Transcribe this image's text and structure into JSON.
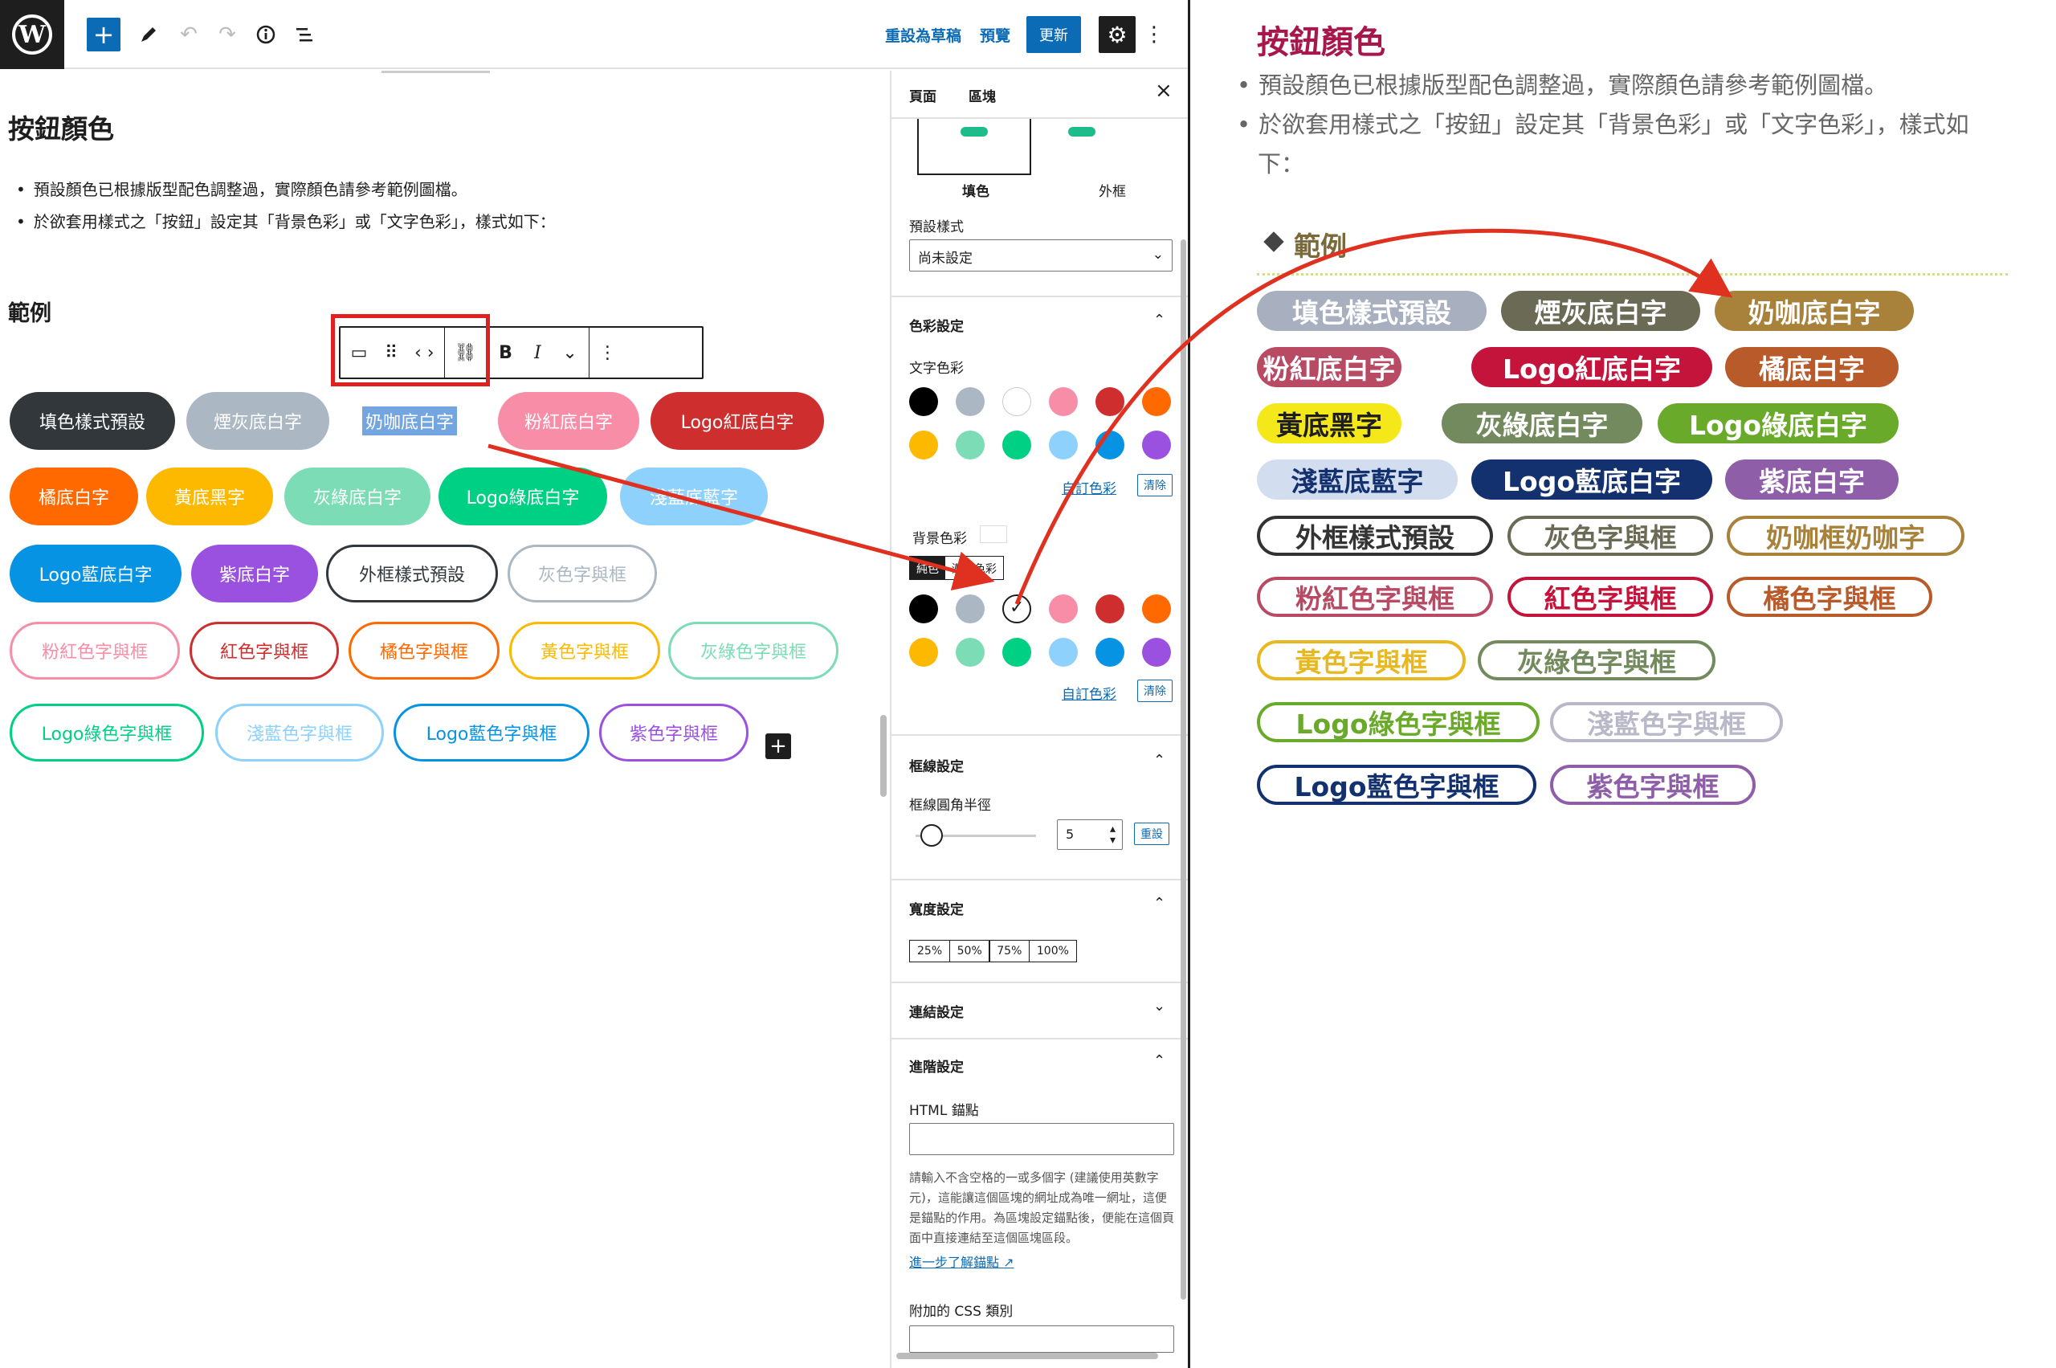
{
  "topbar": {
    "save_draft": "重設為草稿",
    "preview": "預覽",
    "update": "更新",
    "icons": [
      "wordpress-icon",
      "plus-icon",
      "pencil-icon",
      "undo-icon",
      "redo-icon",
      "info-icon",
      "list-view-icon",
      "gear-icon",
      "more-vertical-icon"
    ]
  },
  "canvas": {
    "heading": "按鈕顏色",
    "bullets": [
      "預設顏色已根據版型配色調整過，實際顏色請參考範例圖檔。",
      "於欲套用樣式之「按鈕」設定其「背景色彩」或「文字色彩」，樣式如下："
    ],
    "example_heading": "範例",
    "toolbar": {
      "bold": "B",
      "italic": "I"
    },
    "buttons": [
      {
        "label": "填色樣式預設",
        "style": "fill",
        "color": "#32373c"
      },
      {
        "label": "煙灰底白字",
        "style": "fill",
        "color": "#abb8c3"
      },
      {
        "label": "奶咖底白字",
        "style": "selected",
        "color": "#ffffff"
      },
      {
        "label": "粉紅底白字",
        "style": "fill",
        "color": "#f78da7"
      },
      {
        "label": "Logo紅底白字",
        "style": "fill",
        "color": "#cf2e2e"
      },
      {
        "label": "橘底白字",
        "style": "fill",
        "color": "#ff6900"
      },
      {
        "label": "黃底黑字",
        "style": "fill",
        "color": "#fcb900"
      },
      {
        "label": "灰綠底白字",
        "style": "fill",
        "color": "#7bdcb5"
      },
      {
        "label": "Logo綠底白字",
        "style": "fill",
        "color": "#00d084"
      },
      {
        "label": "淺藍底藍字",
        "style": "fill",
        "color": "#8ed1fc"
      },
      {
        "label": "Logo藍底白字",
        "style": "fill",
        "color": "#0693e3"
      },
      {
        "label": "紫底白字",
        "style": "fill",
        "color": "#9b51e0"
      },
      {
        "label": "外框樣式預設",
        "style": "outline",
        "color": "#32373c"
      },
      {
        "label": "灰色字與框",
        "style": "outline",
        "color": "#abb8c3"
      },
      {
        "label": "粉紅色字與框",
        "style": "outline",
        "color": "#f78da7"
      },
      {
        "label": "紅色字與框",
        "style": "outline",
        "color": "#cf2e2e"
      },
      {
        "label": "橘色字與框",
        "style": "outline",
        "color": "#ff6900"
      },
      {
        "label": "黃色字與框",
        "style": "outline",
        "color": "#fcb900"
      },
      {
        "label": "灰綠色字與框",
        "style": "outline",
        "color": "#7bdcb5"
      },
      {
        "label": "Logo綠色字與框",
        "style": "outline",
        "color": "#00d084"
      },
      {
        "label": "淺藍色字與框",
        "style": "outline",
        "color": "#8ed1fc"
      },
      {
        "label": "Logo藍色字與框",
        "style": "outline",
        "color": "#0693e3"
      },
      {
        "label": "紫色字與框",
        "style": "outline",
        "color": "#9b51e0"
      }
    ]
  },
  "sidebar": {
    "tab_page": "頁面",
    "tab_block": "區塊",
    "style_fill": "填色",
    "style_outline": "外框",
    "preset_label": "預設樣式",
    "preset_value": "尚未設定",
    "color_settings": "色彩設定",
    "text_color": "文字色彩",
    "bg_color": "背景色彩",
    "solid": "純色",
    "gradient": "漸層色彩",
    "custom_color": "自訂色彩",
    "clear": "清除",
    "palette": [
      "#000000",
      "#abb8c3",
      "#ffffff",
      "#f78da7",
      "#cf2e2e",
      "#ff6900",
      "#fcb900",
      "#7bdcb5",
      "#00d084",
      "#8ed1fc",
      "#0693e3",
      "#9b51e0"
    ],
    "border_settings": "框線設定",
    "border_radius": "框線圓角半徑",
    "radius_value": "5",
    "reset": "重設",
    "width_settings": "寬度設定",
    "widths": [
      "25%",
      "50%",
      "75%",
      "100%"
    ],
    "link_settings": "連結設定",
    "advanced": "進階設定",
    "html_anchor": "HTML 錨點",
    "help_text": "請輸入不含空格的一或多個字 (建議使用英數字元)，這能讓這個區塊的網址成為唯一網址，這便是錨點的作用。為區塊設定錨點後，便能在這個頁面中直接連結至這個區塊區段。",
    "learn_more": "進一步了解錨點",
    "extra_css": "附加的 CSS 類別"
  },
  "preview": {
    "title": "按鈕顏色",
    "bullets": [
      "預設顏色已根據版型配色調整過，實際顏色請參考範例圖檔。",
      "於欲套用樣式之「按鈕」設定其「背景色彩」或「文字色彩」，樣式如下："
    ],
    "example_heading": "範例",
    "buttons": [
      {
        "label": "填色樣式預設",
        "style": "fill",
        "color": "#a8b0bf"
      },
      {
        "label": "煙灰底白字",
        "style": "fill",
        "color": "#6b6a55"
      },
      {
        "label": "奶咖底白字",
        "style": "fill",
        "color": "#a8823a"
      },
      {
        "label": "粉紅底白字",
        "style": "fill",
        "color": "#b84a64"
      },
      {
        "label": "Logo紅底白字",
        "style": "fill",
        "color": "#c4143c"
      },
      {
        "label": "橘底白字",
        "style": "fill",
        "color": "#b85a2a"
      },
      {
        "label": "黃底黑字",
        "style": "fill-dark",
        "color": "#f5e81a"
      },
      {
        "label": "灰綠底白字",
        "style": "fill",
        "color": "#738a5e"
      },
      {
        "label": "Logo綠底白字",
        "style": "fill",
        "color": "#6aaa2a"
      },
      {
        "label": "淺藍底藍字",
        "style": "fill-blue",
        "color": "#d3ddf0"
      },
      {
        "label": "Logo藍底白字",
        "style": "fill",
        "color": "#12316e"
      },
      {
        "label": "紫底白字",
        "style": "fill",
        "color": "#8e5ea8"
      },
      {
        "label": "外框樣式預設",
        "style": "outline",
        "color": "#333333"
      },
      {
        "label": "灰色字與框",
        "style": "outline",
        "color": "#6b6a55"
      },
      {
        "label": "奶咖框奶咖字",
        "style": "outline",
        "color": "#a8823a"
      },
      {
        "label": "粉紅色字與框",
        "style": "outline",
        "color": "#b84a64"
      },
      {
        "label": "紅色字與框",
        "style": "outline",
        "color": "#c4143c"
      },
      {
        "label": "橘色字與框",
        "style": "outline",
        "color": "#b85a2a"
      },
      {
        "label": "黃色字與框",
        "style": "outline",
        "color": "#e8b820"
      },
      {
        "label": "灰綠色字與框",
        "style": "outline",
        "color": "#738a5e"
      },
      {
        "label": "Logo綠色字與框",
        "style": "outline",
        "color": "#6aaa2a"
      },
      {
        "label": "淺藍色字與框",
        "style": "outline",
        "color": "#b8b8c8"
      },
      {
        "label": "Logo藍色字與框",
        "style": "outline",
        "color": "#12316e"
      },
      {
        "label": "紫色字與框",
        "style": "outline",
        "color": "#8e5ea8"
      }
    ]
  },
  "annotation_color": "#e03020"
}
